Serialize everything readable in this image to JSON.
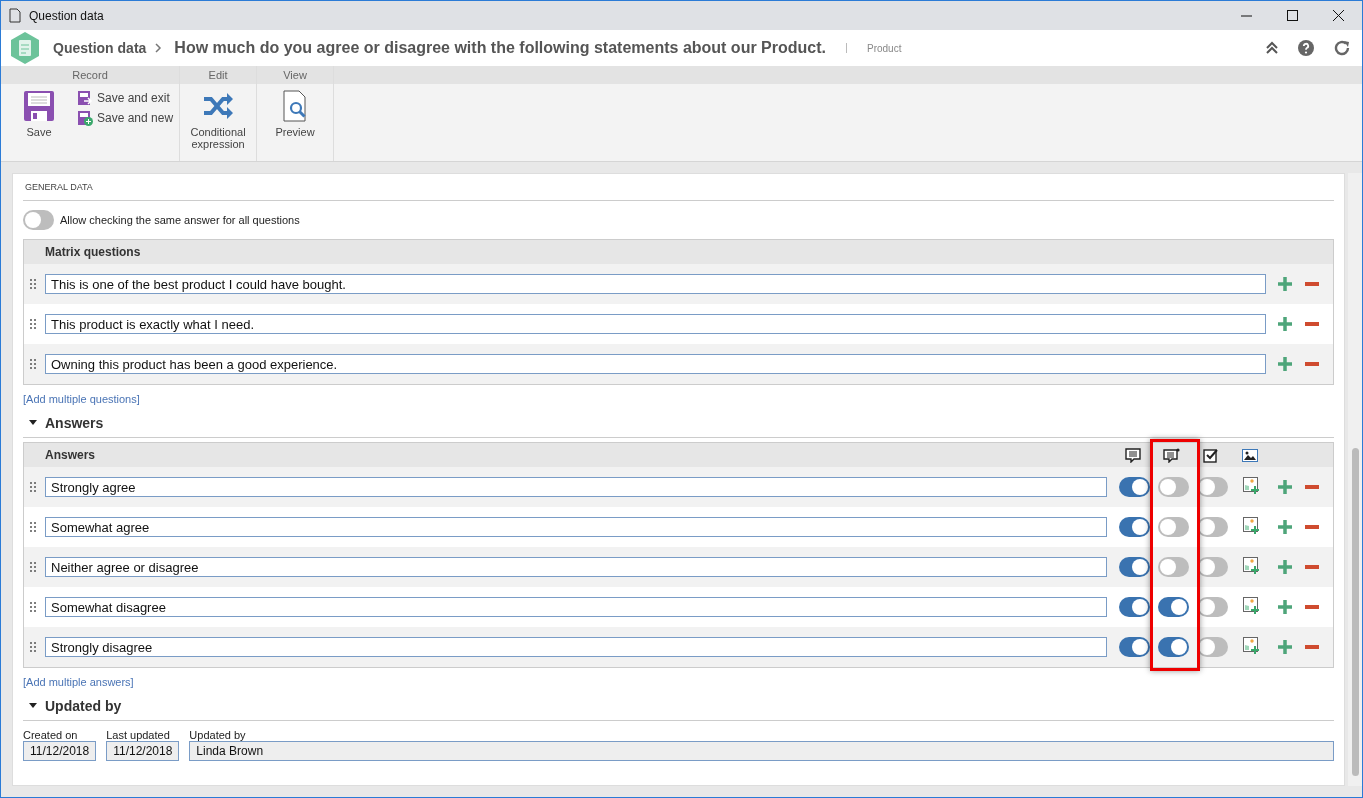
{
  "window": {
    "title": "Question data"
  },
  "header": {
    "breadcrumb": "Question data",
    "title": "How much do you agree or disagree with the following statements about our Product.",
    "tag": "Product"
  },
  "ribbon": [
    {
      "label": "Record",
      "items": [
        {
          "kind": "large",
          "label": "Save"
        },
        {
          "kind": "small",
          "label": "Save and exit"
        },
        {
          "kind": "small",
          "label": "Save and new"
        }
      ]
    },
    {
      "label": "Edit",
      "items": [
        {
          "kind": "large",
          "label": "Conditional expression"
        }
      ]
    },
    {
      "label": "View",
      "items": [
        {
          "kind": "large",
          "label": "Preview"
        }
      ]
    }
  ],
  "general": {
    "title": "GENERAL DATA",
    "toggle": {
      "label": "Allow checking the same answer for all questions",
      "on": false
    },
    "matrix": {
      "heading": "Matrix questions",
      "rows": [
        "This is one of the best product I could have bought.",
        "This product is exactly what I need.",
        "Owning this product has been a good experience."
      ],
      "add_link": "[Add multiple questions]"
    }
  },
  "answers": {
    "title": "Answers",
    "expanded": true,
    "heading": "Answers",
    "columns": [
      {
        "highlighted": false
      },
      {
        "highlighted": true
      },
      {
        "highlighted": false
      },
      {
        "highlighted": false
      }
    ],
    "rows": [
      {
        "text": "Strongly agree",
        "toggles": [
          true,
          false,
          false
        ]
      },
      {
        "text": "Somewhat agree",
        "toggles": [
          true,
          false,
          false
        ]
      },
      {
        "text": "Neither agree or disagree",
        "toggles": [
          true,
          false,
          false
        ]
      },
      {
        "text": "Somewhat disagree",
        "toggles": [
          true,
          true,
          false
        ]
      },
      {
        "text": "Strongly disagree",
        "toggles": [
          true,
          true,
          false
        ]
      }
    ],
    "add_link": "[Add multiple answers]"
  },
  "updated": {
    "title": "Updated by",
    "expanded": true,
    "fields": [
      {
        "label": "Created on",
        "value": "11/12/2018"
      },
      {
        "label": "Last updated",
        "value": "11/12/2018"
      },
      {
        "label": "Updated by",
        "value": "Linda Brown"
      }
    ]
  }
}
